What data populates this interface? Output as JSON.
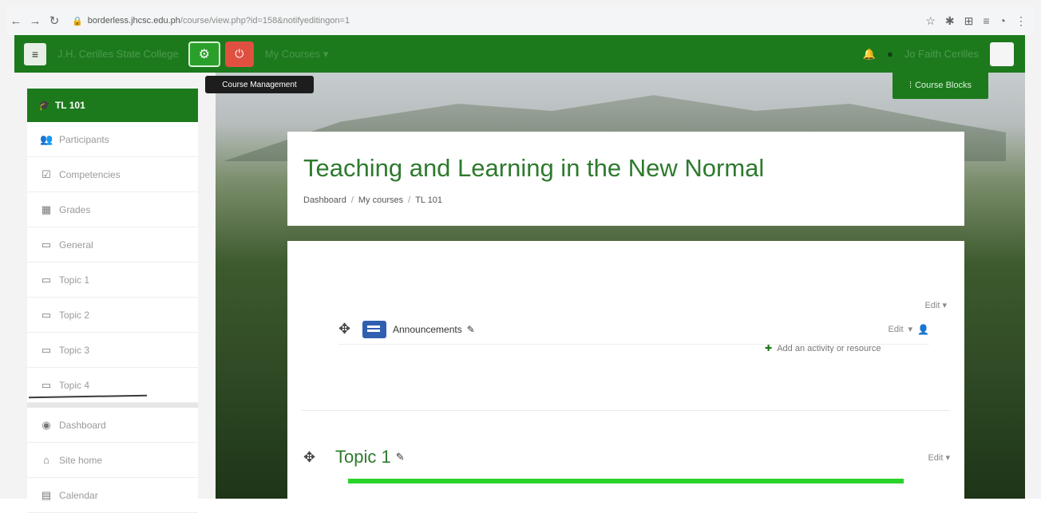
{
  "browser": {
    "url_host": "borderless.jhcsc.edu.ph",
    "url_path": "/course/view.php?id=158&notifyeditingon=1"
  },
  "navbar": {
    "site_name": "J.H. Cerilles State College",
    "my_courses": "My Courses",
    "user_name": "Jo Faith Cerilles"
  },
  "tooltip": "Course Management",
  "course_blocks": "Course Blocks",
  "sidebar": {
    "course": "TL 101",
    "items": [
      {
        "label": "Participants",
        "icon": "users-icon"
      },
      {
        "label": "Competencies",
        "icon": "checkbox-icon"
      },
      {
        "label": "Grades",
        "icon": "table-icon"
      },
      {
        "label": "General",
        "icon": "folder-icon"
      },
      {
        "label": "Topic 1",
        "icon": "folder-icon"
      },
      {
        "label": "Topic 2",
        "icon": "folder-icon"
      },
      {
        "label": "Topic 3",
        "icon": "folder-icon"
      },
      {
        "label": "Topic 4",
        "icon": "folder-icon"
      }
    ],
    "bottom_items": [
      {
        "label": "Dashboard",
        "icon": "dashboard-icon"
      },
      {
        "label": "Site home",
        "icon": "home-icon"
      },
      {
        "label": "Calendar",
        "icon": "calendar-icon"
      }
    ]
  },
  "header": {
    "title": "Teaching and Learning in the New Normal",
    "breadcrumb": [
      "Dashboard",
      "My courses",
      "TL 101"
    ]
  },
  "section0": {
    "edit_label": "Edit",
    "activity": {
      "name": "Announcements",
      "edit_label": "Edit"
    },
    "add_label": "Add an activity or resource"
  },
  "topic1": {
    "title": "Topic 1",
    "edit_label": "Edit"
  }
}
